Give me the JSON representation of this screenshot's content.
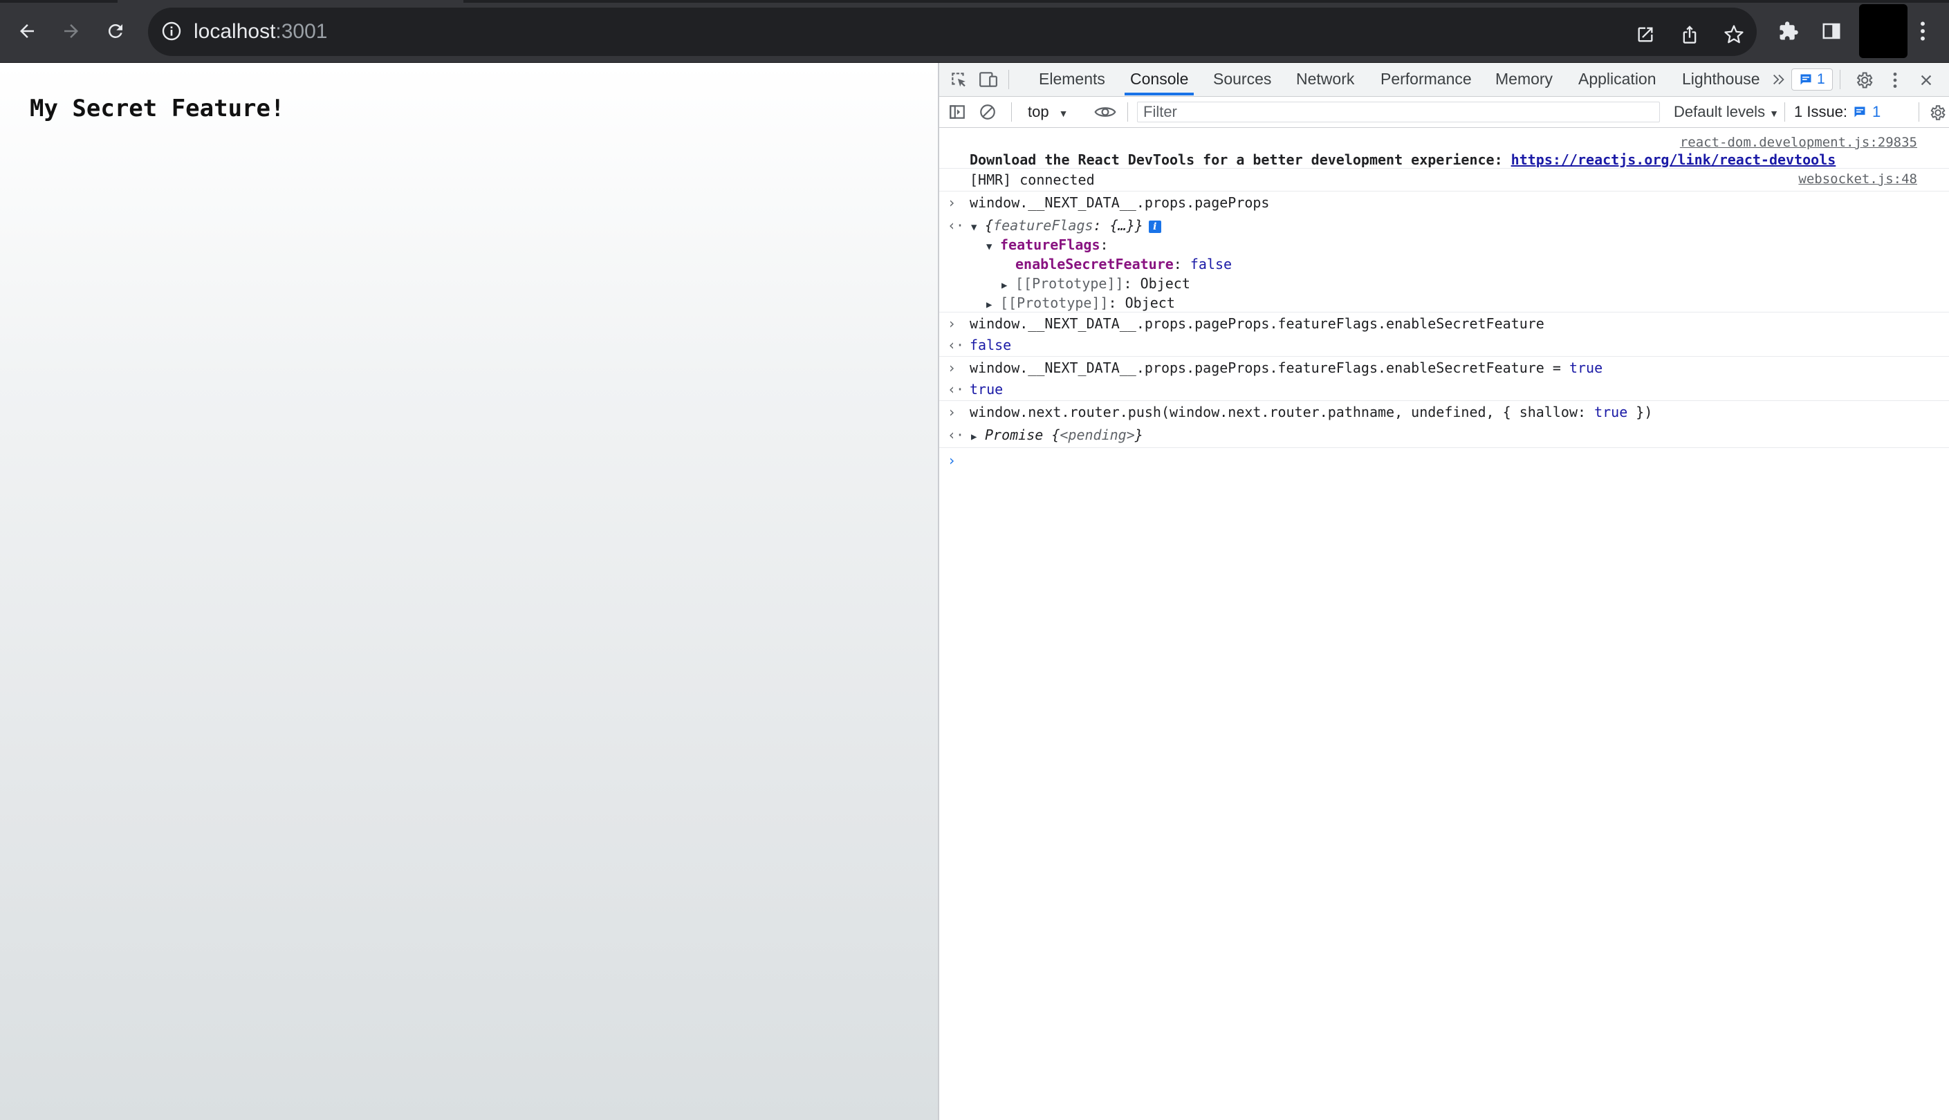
{
  "browser": {
    "url_host": "localhost",
    "url_port": ":3001"
  },
  "page": {
    "heading": "My Secret Feature!"
  },
  "devtools": {
    "tabs": [
      {
        "label": "Elements"
      },
      {
        "label": "Console"
      },
      {
        "label": "Sources"
      },
      {
        "label": "Network"
      },
      {
        "label": "Performance"
      },
      {
        "label": "Memory"
      },
      {
        "label": "Application"
      },
      {
        "label": "Lighthouse"
      }
    ],
    "active_tab": "Console",
    "issues_badge_count": "1",
    "toolbar": {
      "context": "top",
      "filter_placeholder": "Filter",
      "levels": "Default levels",
      "issues_label": "1 Issue:",
      "issues_count": "1"
    }
  },
  "console": {
    "log1": {
      "source": "react-dom.development.js:29835",
      "text": "Download the React DevTools for a better development experience: ",
      "link": "https://reactjs.org/link/react-devtools"
    },
    "log2": {
      "text": "[HMR] connected",
      "source": "websocket.js:48"
    },
    "cmd1": "window.__NEXT_DATA__.props.pageProps",
    "result1": {
      "summary_open": "{",
      "summary_key": "featureFlags",
      "summary_rest": ": {…}}",
      "child_key": "featureFlags",
      "child_colon": ":",
      "flag_key": "enableSecretFeature",
      "flag_colon": ":",
      "flag_value": "false",
      "proto_inner": "[[Prototype]]",
      "proto_inner_val": ": Object",
      "proto_outer": "[[Prototype]]",
      "proto_outer_val": ": Object"
    },
    "cmd2": "window.__NEXT_DATA__.props.pageProps.featureFlags.enableSecretFeature",
    "result2": "false",
    "cmd3_prefix": "window.__NEXT_DATA__.props.pageProps.featureFlags.enableSecretFeature = ",
    "cmd3_value": "true",
    "result3": "true",
    "cmd4_prefix": "window.next.router.push(window.next.router.pathname, undefined, { shallow: ",
    "cmd4_value": "true",
    "cmd4_suffix": " })",
    "result4": {
      "name": "Promise ",
      "open": "{",
      "state": "<pending>",
      "close": "}"
    }
  }
}
